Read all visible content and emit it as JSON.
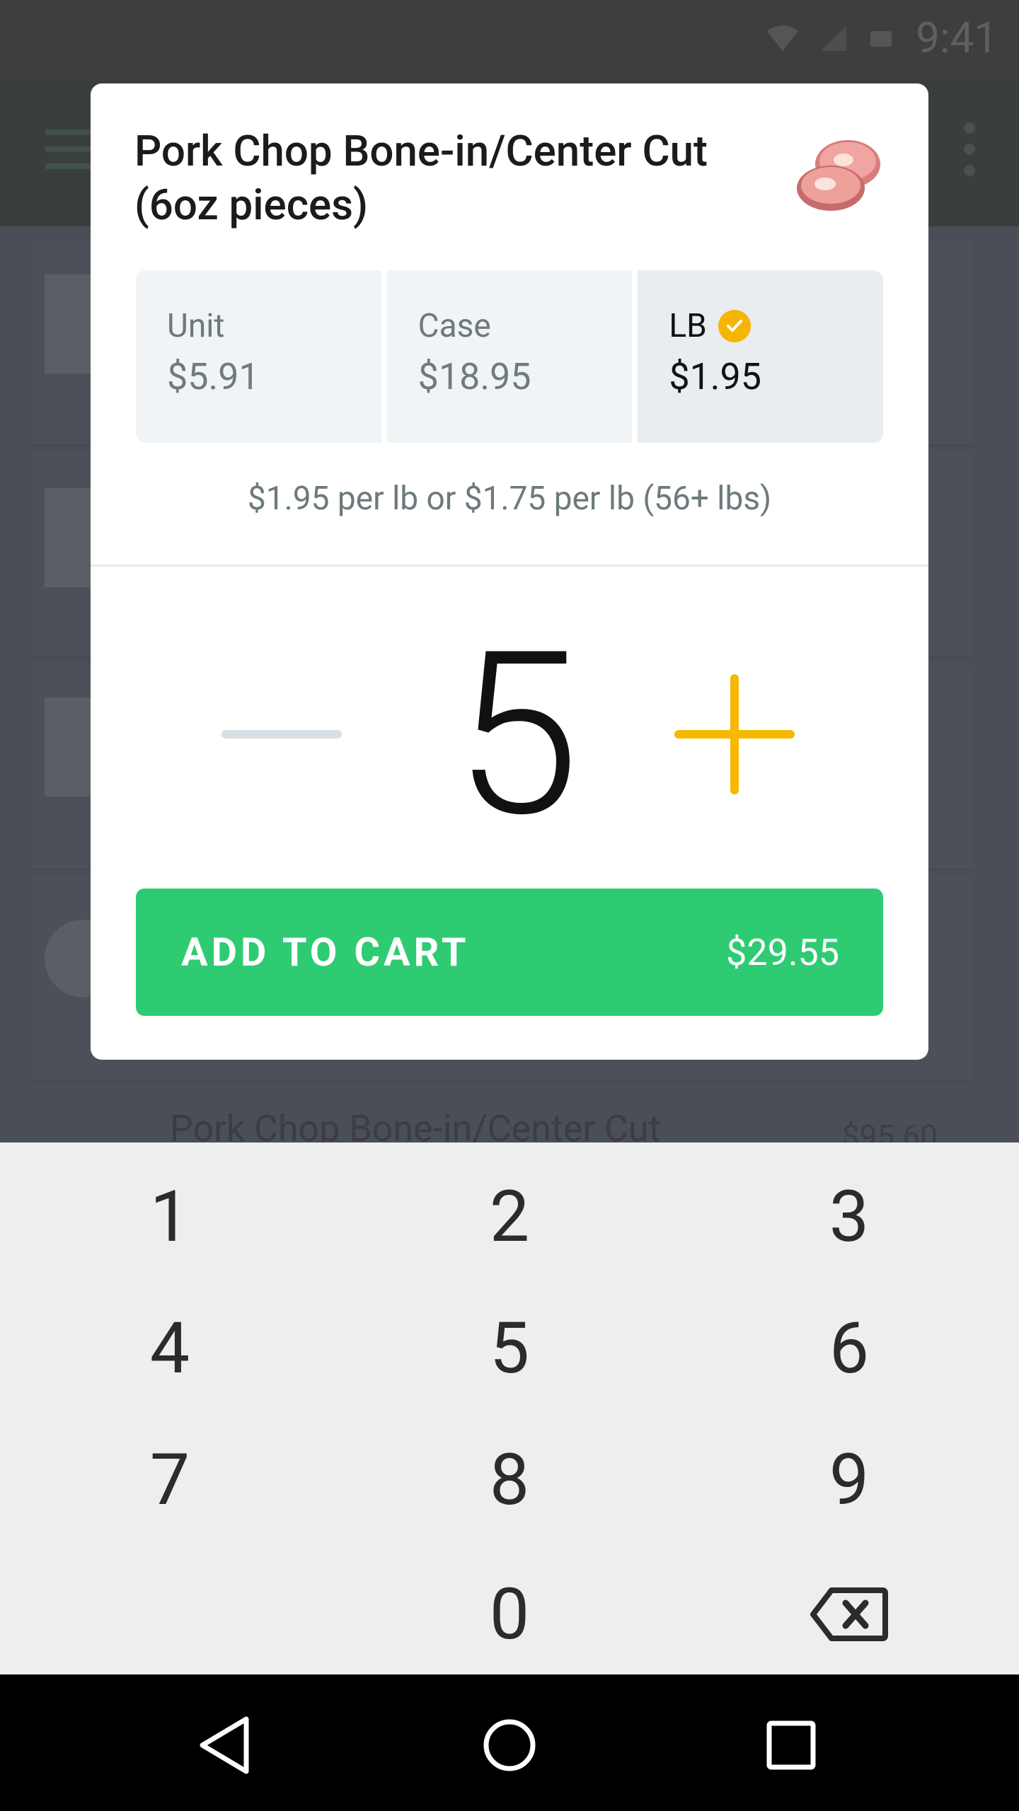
{
  "status_bar": {
    "time": "9:41"
  },
  "background_list": {
    "row_title": "Pork Chop Bone-in/Center Cut",
    "row_price": "$95.60"
  },
  "dialog": {
    "title": "Pork Chop Bone-in/Center Cut (6oz pieces)",
    "image": "pork-chop-image",
    "price_options": [
      {
        "label": "Unit",
        "price": "$5.91",
        "selected": false
      },
      {
        "label": "Case",
        "price": "$18.95",
        "selected": false
      },
      {
        "label": "LB",
        "price": "$1.95",
        "selected": true
      }
    ],
    "price_note": "$1.95 per lb or $1.75 per lb (56+ lbs)",
    "quantity": "5",
    "add_to_cart": {
      "label": "ADD TO CART",
      "total": "$29.55"
    },
    "colors": {
      "accent": "#f6b800",
      "cta": "#2fcb73"
    }
  },
  "keypad": {
    "keys": [
      "1",
      "2",
      "3",
      "4",
      "5",
      "6",
      "7",
      "8",
      "9",
      "0"
    ],
    "backspace": "backspace-icon"
  },
  "nav_bar": {
    "buttons": [
      "back-icon",
      "home-icon",
      "recents-icon"
    ]
  }
}
